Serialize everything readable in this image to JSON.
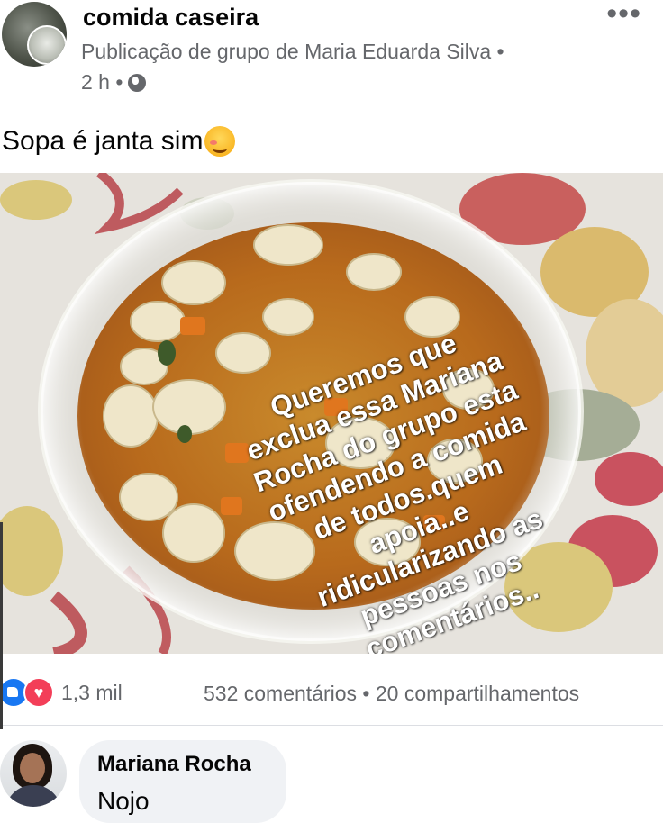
{
  "post": {
    "group_name": "comida caseira",
    "meta": "Publicação de grupo de Maria Eduarda Silva •",
    "time": "2 h •",
    "more_label": "•••",
    "text": "Sopa é janta sim",
    "emoji_icon": "smiling-face-icon",
    "photo_overlay_lines": [
      "Queremos que",
      "exclua essa Mariana",
      "Rocha do grupo esta",
      "ofendendo a comida",
      "de todos.quem",
      "apoia..e",
      "ridicularizando as",
      "pessoas nos",
      "comentários.."
    ]
  },
  "engagement": {
    "reaction_icons": [
      "like-icon",
      "love-icon"
    ],
    "reactions": "1,3 mil",
    "summary": "532 comentários • 20 compartilhamentos"
  },
  "comment": {
    "author": "Mariana Rocha",
    "text": "Nojo"
  },
  "colors": {
    "secondary_text": "#65676b",
    "like_blue": "#1877f2",
    "love_red": "#f33e58",
    "comment_bubble": "#f0f2f5"
  }
}
